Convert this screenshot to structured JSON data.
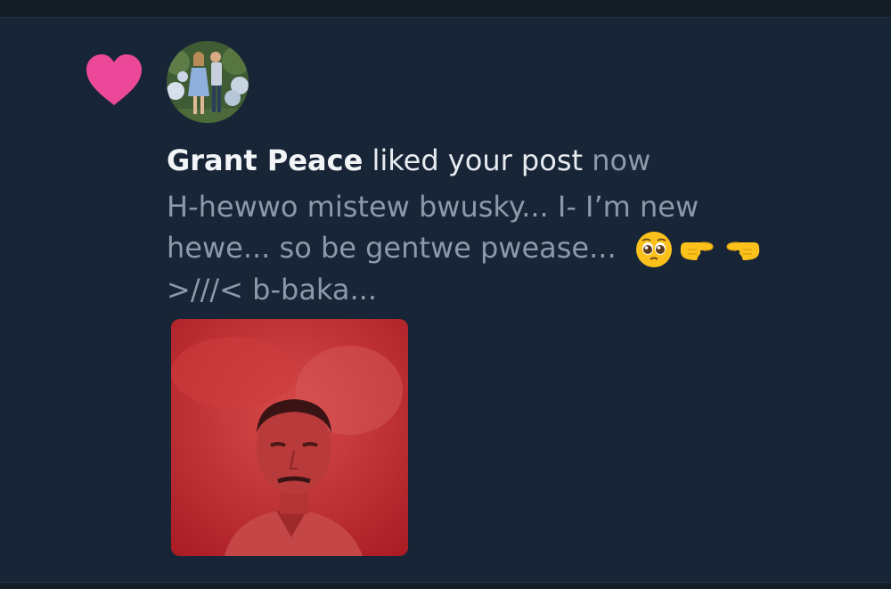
{
  "notification": {
    "user_name": "Grant Peace",
    "action_text": "liked your post",
    "time": "now"
  },
  "post": {
    "line1": "H-hewwo mistew bwusky... I- I’m new",
    "line2": "hewe... so be gentwe pwease...",
    "line3": ">///< b-baka...",
    "emojis": [
      "pleading-face",
      "backhand-index-pointing-right",
      "backhand-index-pointing-left"
    ]
  },
  "colors": {
    "background": "#182537",
    "like_heart": "#ec4899",
    "primary_text": "#e7ecf1",
    "secondary_text": "#8b99aa"
  }
}
